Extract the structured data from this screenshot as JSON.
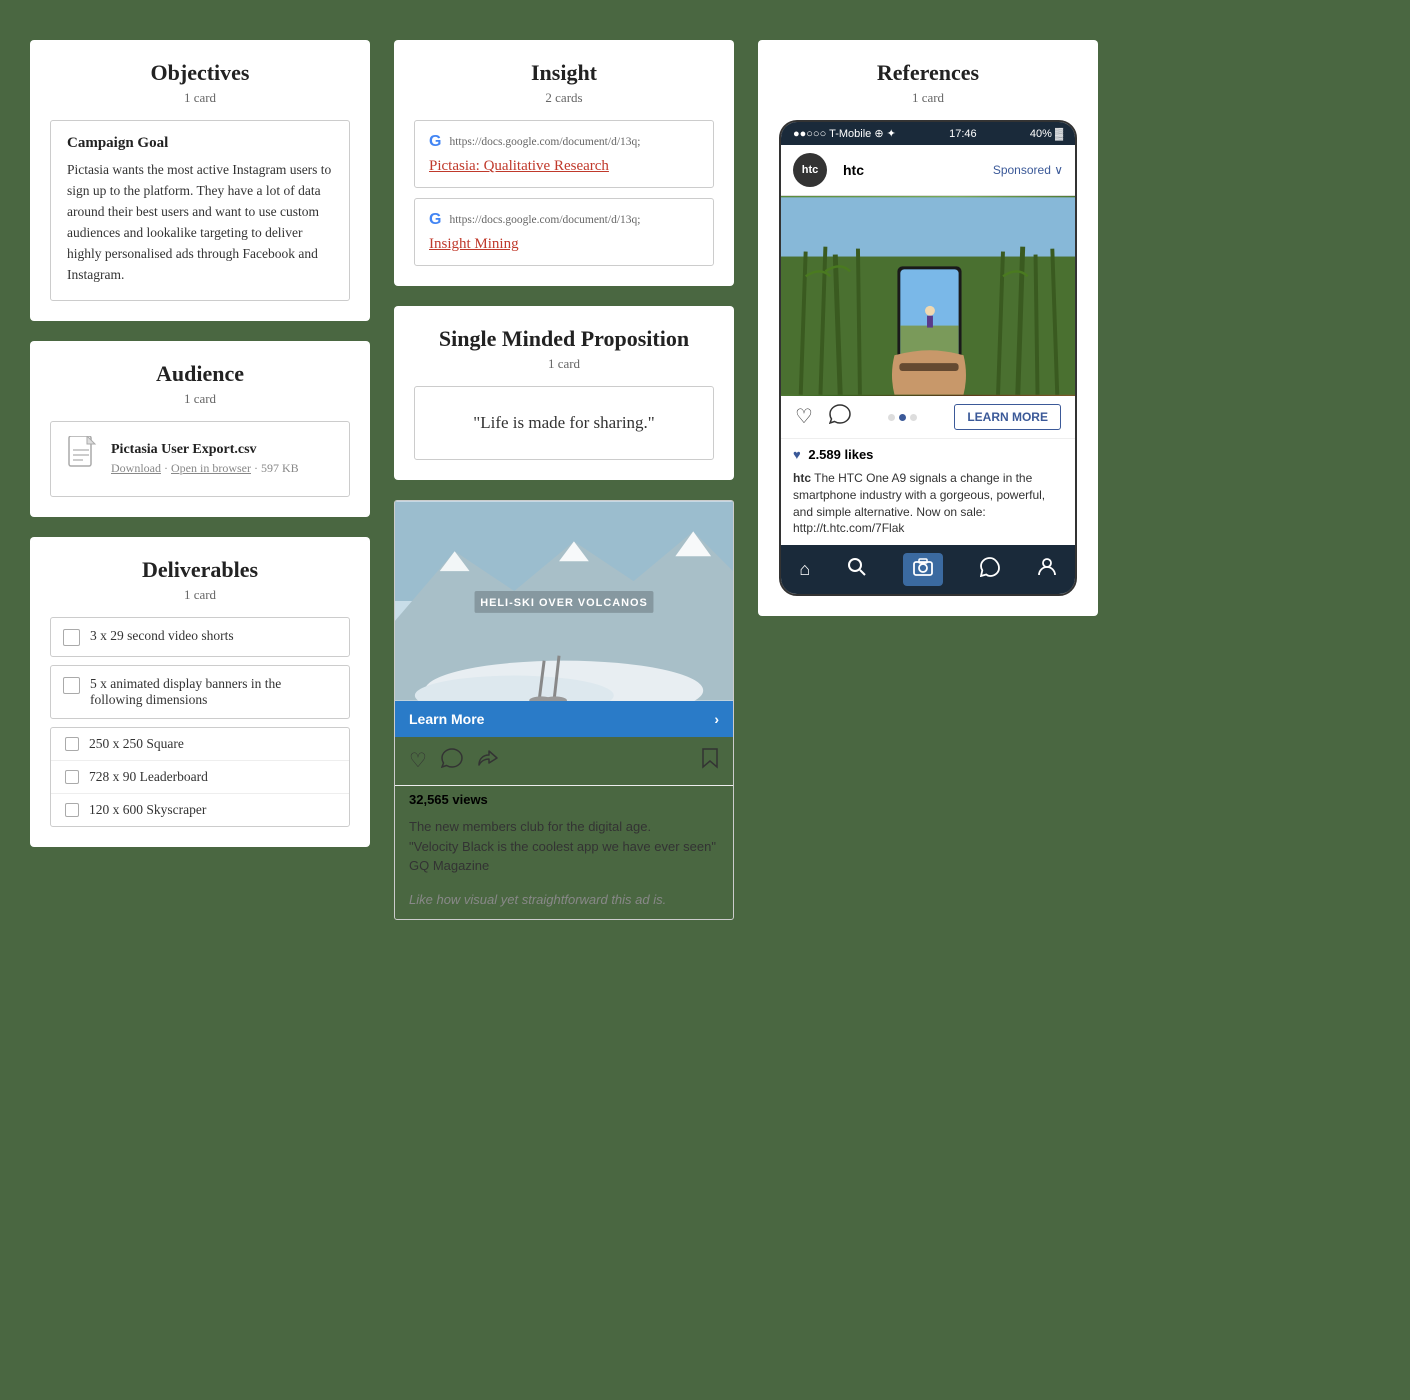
{
  "background_color": "#4a6741",
  "columns": {
    "left": {
      "objectives": {
        "title": "Objectives",
        "count": "1 card",
        "campaign_goal": {
          "title": "Campaign Goal",
          "text": "Pictasia wants the most active Instagram users to sign up to the platform. They have a lot of data around their best users and want to use custom audiences and lookalike targeting to deliver highly personalised ads through Facebook and Instagram."
        }
      },
      "audience": {
        "title": "Audience",
        "count": "1 card",
        "file": {
          "name": "Pictasia User Export.csv",
          "actions": "Download · Open in browser · 597 KB"
        }
      },
      "deliverables": {
        "title": "Deliverables",
        "count": "1 card",
        "items": [
          {
            "label": "3 x 29 second video shorts",
            "indent": 0
          },
          {
            "label": "5 x animated display banners in the following dimensions",
            "indent": 0
          },
          {
            "label": "250 x 250 Square",
            "indent": 1
          },
          {
            "label": "728 x 90 Leaderboard",
            "indent": 1
          },
          {
            "label": "120 x 600 Skyscraper",
            "indent": 1
          }
        ]
      }
    },
    "middle": {
      "insight": {
        "title": "Insight",
        "count": "2 cards",
        "cards": [
          {
            "url": "https://docs.google.com/document/d/13q;",
            "link_text": "Pictasia: Qualitative Research"
          },
          {
            "url": "https://docs.google.com/document/d/13q;",
            "link_text": "Insight Mining"
          }
        ]
      },
      "smp": {
        "title": "Single Minded Proposition",
        "count": "1 card",
        "quote": "\"Life is made for sharing.\""
      },
      "insta_post": {
        "banner_text": "Learn More",
        "chevron": "›",
        "views": "32,565 views",
        "caption_line1": "The new members club for the digital age.",
        "caption_line2": "\"Velocity Black is the coolest app we have ever seen\" GQ Magazine",
        "comment": "Like how visual yet straightforward this ad is.",
        "image_overlay_text": "HELI-SKI OVER VOLCANOS"
      }
    },
    "right": {
      "references": {
        "title": "References",
        "count": "1 card",
        "phone": {
          "status_left": "●●○○○ T-Mobile ⊕",
          "status_time": "17:46",
          "status_right": "40%",
          "brand": "htc",
          "brand_label": "htc",
          "sponsored": "Sponsored ∨",
          "likes": "2.589 likes",
          "caption_brand": "htc",
          "caption_text": "The HTC One A9 signals a change in the smartphone industry with a gorgeous, powerful, and simple alternative. Now on sale: http://t.htc.com/7Flak"
        }
      }
    }
  }
}
